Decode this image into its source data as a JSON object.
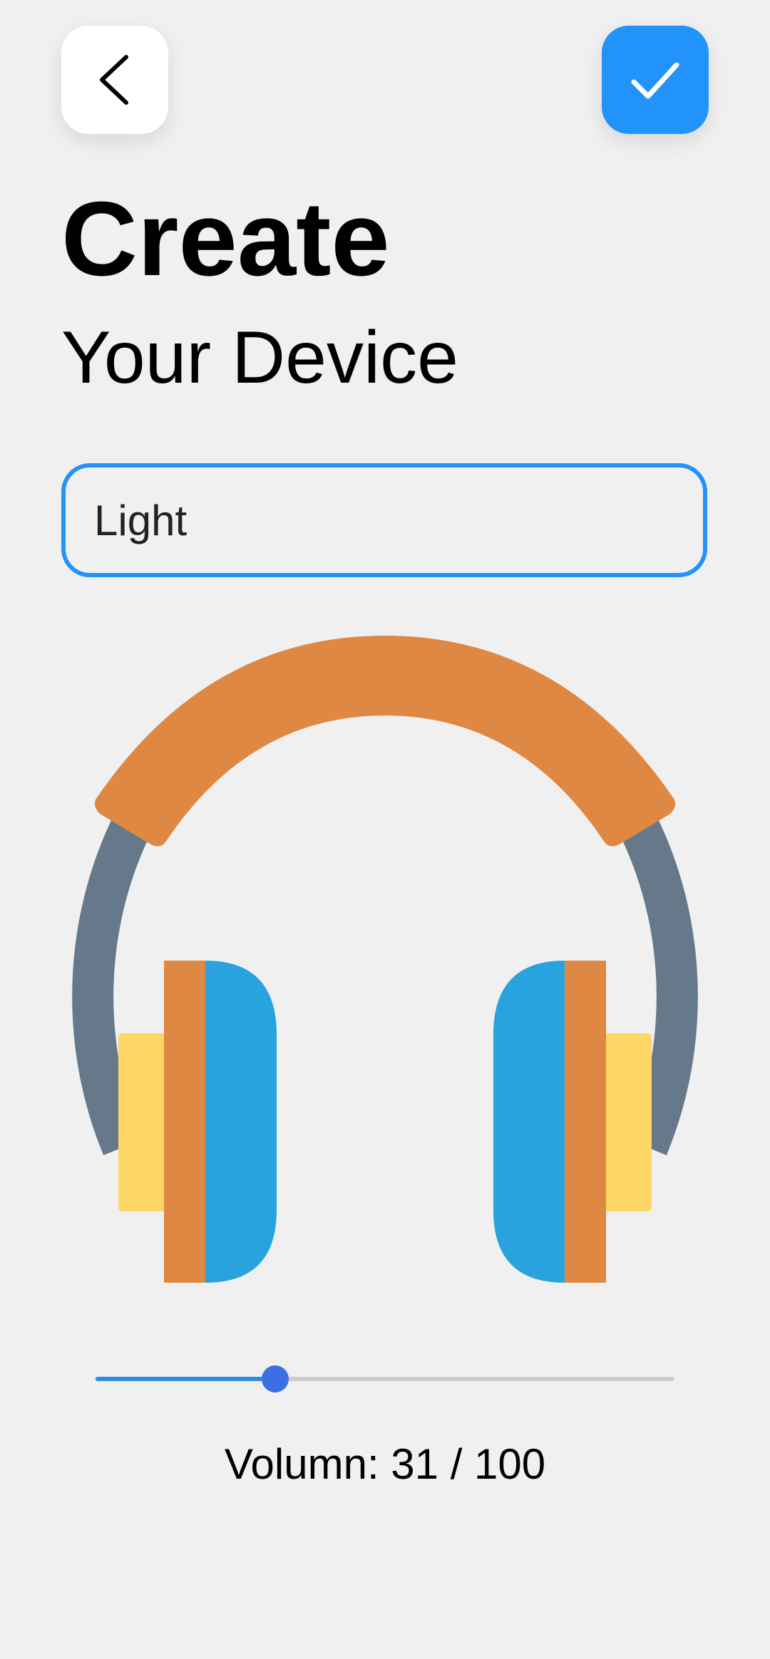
{
  "header": {
    "back_icon": "chevron-left-icon",
    "confirm_icon": "checkmark-icon",
    "confirm_color": "#2293fb"
  },
  "title": "Create",
  "subtitle": "Your Device",
  "device_name": {
    "value": "Light",
    "border_color": "#2293fb"
  },
  "device_image": {
    "icon": "headphones-icon",
    "colors": {
      "headband": "#de8843",
      "frame": "#66798b",
      "earcup": "#29a3dd",
      "cushion": "#fdd665"
    }
  },
  "volume": {
    "value": 31,
    "max": 100,
    "label": "Volumn: 31 / 100"
  }
}
